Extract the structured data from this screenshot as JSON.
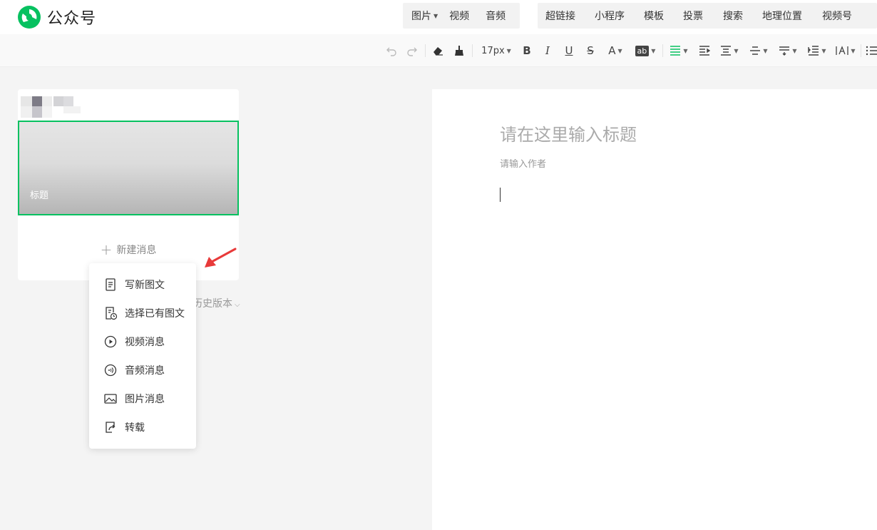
{
  "header": {
    "logo_text": "公众号",
    "insert_media": [
      {
        "label": "图片",
        "caret": true
      },
      {
        "label": "视频",
        "caret": false
      },
      {
        "label": "音频",
        "caret": false
      }
    ],
    "insert_tools": [
      {
        "label": "超链接"
      },
      {
        "label": "小程序"
      },
      {
        "label": "模板"
      },
      {
        "label": "投票"
      },
      {
        "label": "搜索"
      },
      {
        "label": "地理位置"
      },
      {
        "label": "视频号"
      }
    ]
  },
  "toolbar": {
    "font_size": "17px",
    "bold": "B",
    "italic": "I",
    "underline": "U",
    "strike": "S",
    "font_color": "A",
    "bg_color": "ab",
    "accent_color": "#07c160"
  },
  "left_panel": {
    "cover_title": "标题",
    "new_message_label": "新建消息",
    "history_label": "历史版本",
    "dropdown_items": [
      {
        "label": "写新图文",
        "icon": "document-icon"
      },
      {
        "label": "选择已有图文",
        "icon": "document-clock-icon"
      },
      {
        "label": "视频消息",
        "icon": "play-circle-icon"
      },
      {
        "label": "音频消息",
        "icon": "audio-circle-icon"
      },
      {
        "label": "图片消息",
        "icon": "image-icon"
      },
      {
        "label": "转载",
        "icon": "share-icon"
      }
    ]
  },
  "editor": {
    "title_placeholder": "请在这里输入标题",
    "author_placeholder": "请输入作者"
  },
  "colors": {
    "brand_green": "#07c160",
    "arrow_red": "#e83a3a"
  }
}
